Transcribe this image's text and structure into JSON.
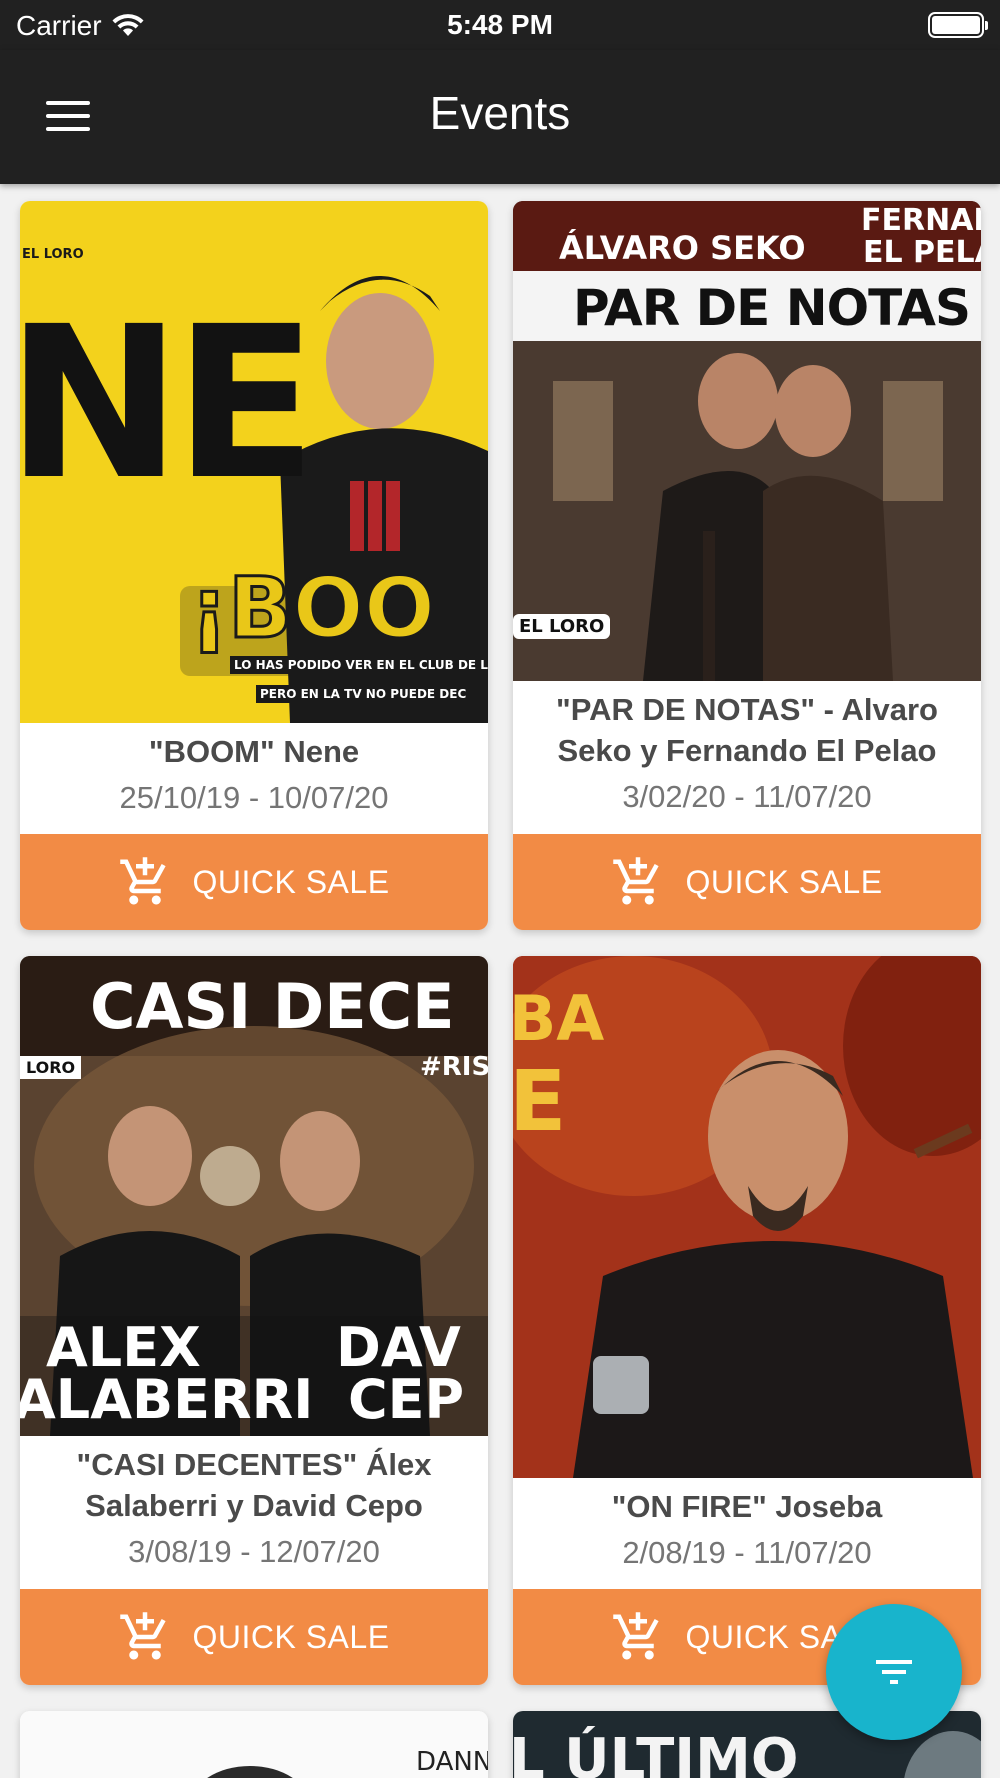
{
  "status_bar": {
    "carrier": "Carrier",
    "time": "5:48 PM"
  },
  "app_bar": {
    "title": "Events",
    "menu_icon": "hamburger-menu-icon"
  },
  "events": [
    {
      "poster_text": [
        "NE",
        "EL LORO",
        "¡BOO",
        "LO HAS PODIDO VER EN EL CLUB DE LA COM",
        "PERO EN LA TV NO PUEDE DEC"
      ],
      "name": "\"BOOM\" Nene",
      "dates": "25/10/19 - 10/07/20",
      "button_label": "QUICK SALE"
    },
    {
      "poster_text": [
        "ÁLVARO SEKO",
        "FERNAN",
        "EL PELA",
        "PAR DE NOTAS",
        "EL LORO"
      ],
      "name": "\"PAR DE NOTAS\" - Alvaro Seko y Fernando El Pelao",
      "dates": "3/02/20 - 11/07/20",
      "button_label": "QUICK SALE"
    },
    {
      "poster_text": [
        "CASI DECE",
        "#RIS",
        "LORO",
        "ALEX",
        "ALABERRI",
        "DAV",
        "CEP"
      ],
      "name": "\"CASI DECENTES\" Álex Salaberri y David Cepo",
      "dates": "3/08/19 - 12/07/20",
      "button_label": "QUICK SALE"
    },
    {
      "poster_text": [
        "BA",
        "E"
      ],
      "name": "\"ON FIRE\" Joseba",
      "dates": "2/08/19 - 11/07/20",
      "button_label": "QUICK SALE"
    }
  ],
  "partial_cards": [
    {
      "poster_text": "DANNY"
    },
    {
      "poster_text": "L ÚLTIMO"
    }
  ],
  "fab": {
    "icon": "filter-icon"
  },
  "colors": {
    "app_bar": "#212121",
    "button": "#f28b45",
    "fab": "#18b4cc",
    "background": "#f1f1f1"
  }
}
